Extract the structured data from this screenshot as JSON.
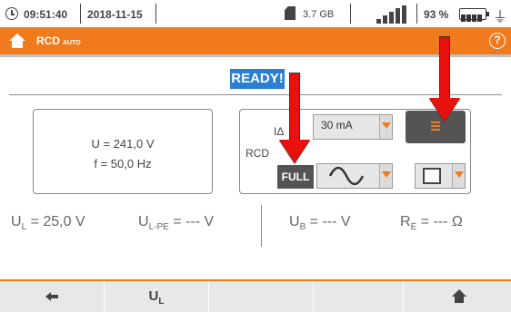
{
  "status_bar": {
    "time": "09:51:40",
    "date": "2018-11-15",
    "storage": "3.7 GB",
    "battery_percent": "93 %",
    "icons": [
      "clock-icon",
      "sd-card-icon",
      "signal-icon",
      "battery-icon",
      "power-plug-icon"
    ]
  },
  "header": {
    "title": "RCD",
    "subtitle": "AUTO",
    "help_label": "?",
    "accent_color": "#f07a1c"
  },
  "status": {
    "ready_label": "READY!"
  },
  "info": {
    "voltage": "U = 241,0 V",
    "frequency": "f = 50,0 Hz"
  },
  "rcd_panel": {
    "current_label": "IΔ",
    "current_value": "30 mA",
    "rcd_label": "RCD",
    "full_label": "FULL"
  },
  "measurements": {
    "ul": {
      "symbol": "U",
      "sub": "L",
      "rest": " = 25,0 V"
    },
    "ulpe": {
      "symbol": "U",
      "sub": "L-PE",
      "rest": " = --- V"
    },
    "ub": {
      "symbol": "U",
      "sub": "B",
      "rest": " = --- V"
    },
    "re": {
      "symbol": "R",
      "sub": "E",
      "rest": " = --- Ω"
    }
  },
  "nav": {
    "ul_symbol": "U",
    "ul_sub": "L"
  }
}
